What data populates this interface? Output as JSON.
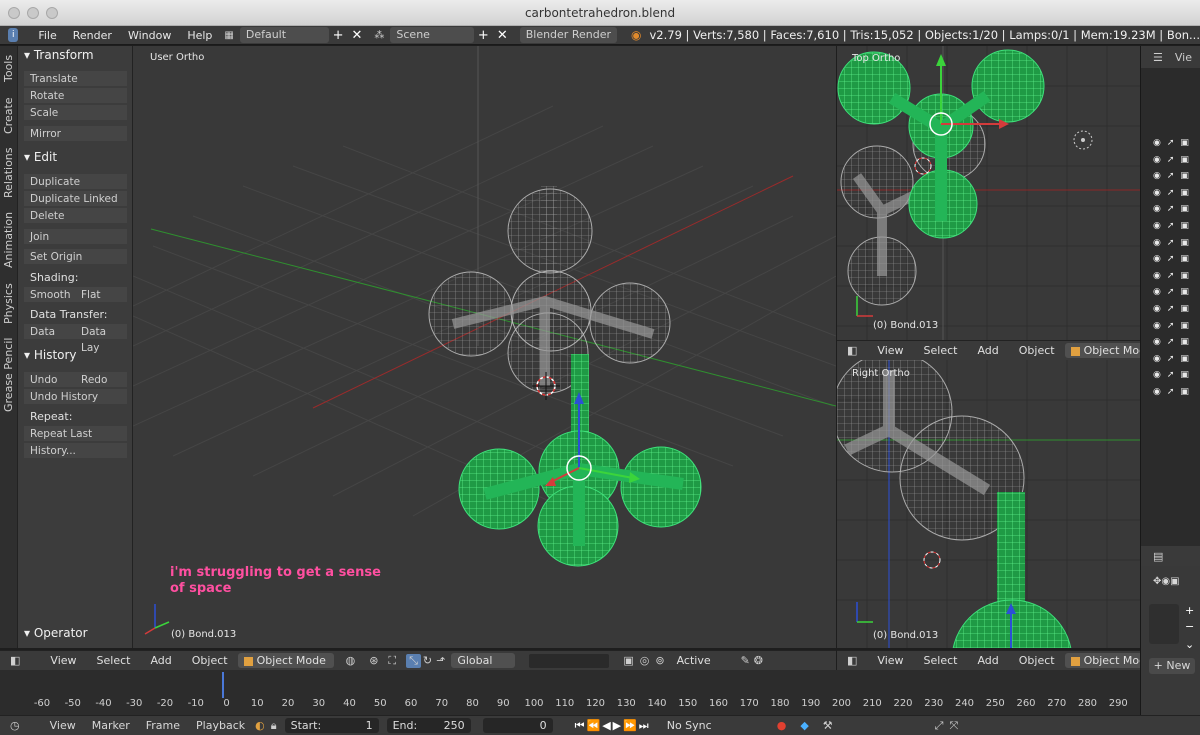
{
  "window": {
    "title": "carbontetrahedron.blend"
  },
  "infobar": {
    "menus": [
      "File",
      "Render",
      "Window",
      "Help"
    ],
    "layout": "Default",
    "scene": "Scene",
    "engine": "Blender Render",
    "stats": "v2.79 | Verts:7,580 | Faces:7,610 | Tris:15,052 | Objects:1/20 | Lamps:0/1 | Mem:19.23M | Bon..."
  },
  "tabs": [
    "Tools",
    "Create",
    "Relations",
    "Animation",
    "Physics",
    "Grease Pencil"
  ],
  "shelf": {
    "transform": {
      "title": "Transform",
      "items": [
        "Translate",
        "Rotate",
        "Scale",
        "Mirror"
      ]
    },
    "edit": {
      "title": "Edit",
      "items": [
        "Duplicate",
        "Duplicate Linked",
        "Delete",
        "Join",
        "Set Origin"
      ],
      "shading_label": "Shading:",
      "smooth": "Smooth",
      "flat": "Flat",
      "transfer_label": "Data Transfer:",
      "data": "Data",
      "data_lay": "Data Lay"
    },
    "history": {
      "title": "History",
      "undo": "Undo",
      "redo": "Redo",
      "undo_history": "Undo History",
      "repeat_label": "Repeat:",
      "repeat_last": "Repeat Last",
      "history_dots": "History..."
    },
    "operator": "Operator"
  },
  "viewports": {
    "main": {
      "label": "User Ortho",
      "object": "(0) Bond.013",
      "annotation": "i'm struggling to get a sense of space"
    },
    "top": {
      "label": "Top Ortho",
      "object": "(0) Bond.013"
    },
    "right": {
      "label": "Right Ortho",
      "object": "(0) Bond.013"
    }
  },
  "vpheader": {
    "menus": [
      "View",
      "Select",
      "Add",
      "Object"
    ],
    "mode": "Object Mode",
    "orientation": "Global",
    "pivot": "Active"
  },
  "timeline": {
    "ticks": [
      "-60",
      "-50",
      "-40",
      "-30",
      "-20",
      "-10",
      "0",
      "10",
      "20",
      "30",
      "40",
      "50",
      "60",
      "70",
      "80",
      "90",
      "100",
      "110",
      "120",
      "130",
      "140",
      "150",
      "160",
      "170",
      "180",
      "190",
      "200",
      "210",
      "220",
      "230",
      "240",
      "250",
      "260",
      "270",
      "280",
      "290"
    ],
    "menus": [
      "View",
      "Marker",
      "Frame",
      "Playback"
    ],
    "start_label": "Start:",
    "start": "1",
    "end_label": "End:",
    "end": "250",
    "current": "0",
    "sync": "No Sync"
  },
  "outliner": {
    "view_label": "Vie"
  },
  "props": {
    "new_label": "New"
  },
  "colors": {
    "selected": "#22c55e",
    "wire": "#b4b4b4",
    "bg": "#393939"
  }
}
